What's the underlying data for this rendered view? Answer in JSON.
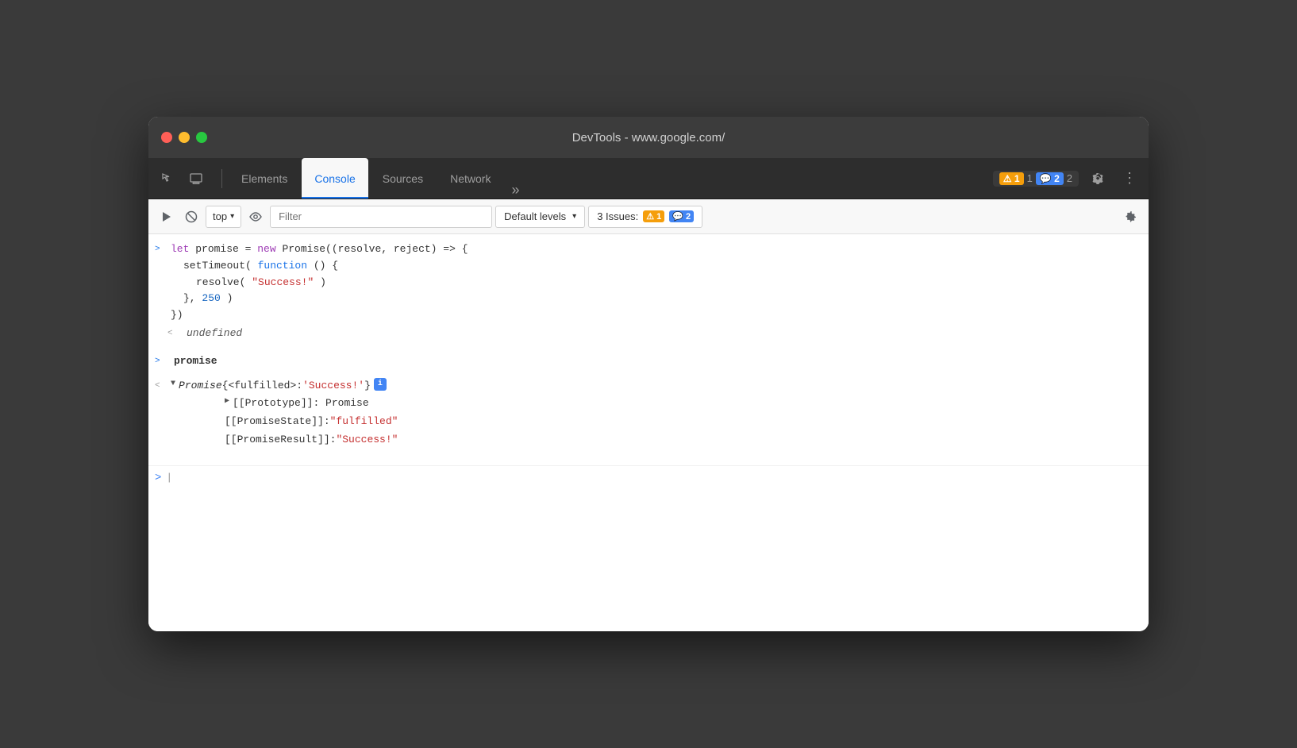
{
  "titlebar": {
    "title": "DevTools - www.google.com/"
  },
  "tabs": {
    "items": [
      {
        "label": "Elements",
        "active": false
      },
      {
        "label": "Console",
        "active": true
      },
      {
        "label": "Sources",
        "active": false
      },
      {
        "label": "Network",
        "active": false
      }
    ],
    "more_label": "»"
  },
  "toolbar": {
    "top_label": "top",
    "filter_placeholder": "Filter",
    "levels_label": "Default levels",
    "issues_label": "3 Issues:",
    "issues_warning_count": "1",
    "issues_info_count": "2"
  },
  "console": {
    "lines": [
      {
        "type": "input",
        "arrow": ">",
        "content": "let promise = new Promise((resolve, reject) => {"
      }
    ],
    "code_block": {
      "line1": "let promise = new Promise((resolve, reject) => {",
      "line2": "  setTimeout( function() {",
      "line3": "    resolve(\"Success!\")",
      "line4": "  }, 250)",
      "line5": "})"
    },
    "undefined_output": "undefined",
    "promise_input": "promise",
    "promise_object": "Promise {<fulfilled>: 'Success!'}",
    "prototype_label": "[[Prototype]]: Promise",
    "state_label": "[[PromiseState]]:",
    "state_value": "\"fulfilled\"",
    "result_label": "[[PromiseResult]]:",
    "result_value": "\"Success!\""
  },
  "icons": {
    "cursor": "⬚",
    "layers": "⬚",
    "play": "▶",
    "ban": "⊘",
    "eye": "👁",
    "gear": "⚙",
    "more_vert": "⋮",
    "chevron_down": "▾",
    "info": "i"
  },
  "colors": {
    "active_tab": "#1a73e8",
    "warning": "#f59e0b",
    "info_blue": "#4285f4",
    "keyword_purple": "#9e3bb5",
    "keyword_blue": "#1a73e8",
    "string_red": "#c53030",
    "number_blue": "#1565c0"
  }
}
